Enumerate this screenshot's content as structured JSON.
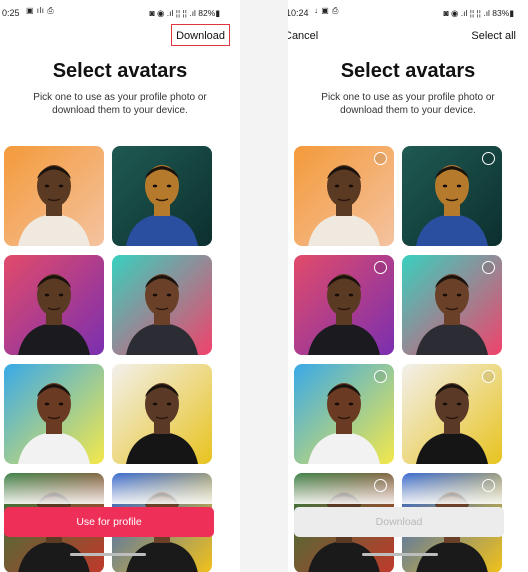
{
  "left": {
    "status": {
      "time": "0:25",
      "icons": "▣ ılı ⎙",
      "right": "◙ ◉ .ıl ¦¦ ¦¦ .ıl 82%▮"
    },
    "download_label": "Download",
    "title": "Select avatars",
    "subtitle": "Pick one to use as your profile photo or download them to your device.",
    "primary_button": "Use for profile"
  },
  "right": {
    "status": {
      "time": "10:24",
      "icons": "↓ ▣ ⎙",
      "right": "◙ ◉ .ıl ¦¦ ¦¦ .ıl 83%▮"
    },
    "cancel_label": "Cancel",
    "select_all_label": "Select all",
    "title": "Select avatars",
    "subtitle": "Pick one to use as your profile photo or download them to your device.",
    "download_button": "Download"
  },
  "avatars": [
    {
      "name": "avatar-floral-orange",
      "bg1": "#f49a3a",
      "bg2": "#f4c3a0",
      "skin": "#5b3a24",
      "shirt": "#efe9e0"
    },
    {
      "name": "avatar-glowing-portrait",
      "bg1": "#1f5a52",
      "bg2": "#0c2f2e",
      "skin": "#b57a2c",
      "shirt": "#2a4fa0"
    },
    {
      "name": "avatar-purple-gradient",
      "bg1": "#e24b6a",
      "bg2": "#7a2fb0",
      "skin": "#5b3a24",
      "shirt": "#1b1b1f"
    },
    {
      "name": "avatar-teal-pink",
      "bg1": "#38d1bf",
      "bg2": "#f1426b",
      "skin": "#6a4128",
      "shirt": "#2c2c34"
    },
    {
      "name": "avatar-paint-splash",
      "bg1": "#39a9e8",
      "bg2": "#f4e84b",
      "skin": "#6b3a22",
      "shirt": "#f2f2f2"
    },
    {
      "name": "avatar-yellow-splash",
      "bg1": "#f2f0ec",
      "bg2": "#e8c31f",
      "skin": "#5a3a26",
      "shirt": "#151515"
    },
    {
      "name": "avatar-partial-green",
      "bg1": "#2f7a3a",
      "bg2": "#c0392b",
      "skin": "#5b3a24",
      "shirt": "#1a1a1a"
    },
    {
      "name": "avatar-partial-blue",
      "bg1": "#2a5fd0",
      "bg2": "#f2c21a",
      "skin": "#6a4128",
      "shirt": "#1a1a1a"
    }
  ]
}
